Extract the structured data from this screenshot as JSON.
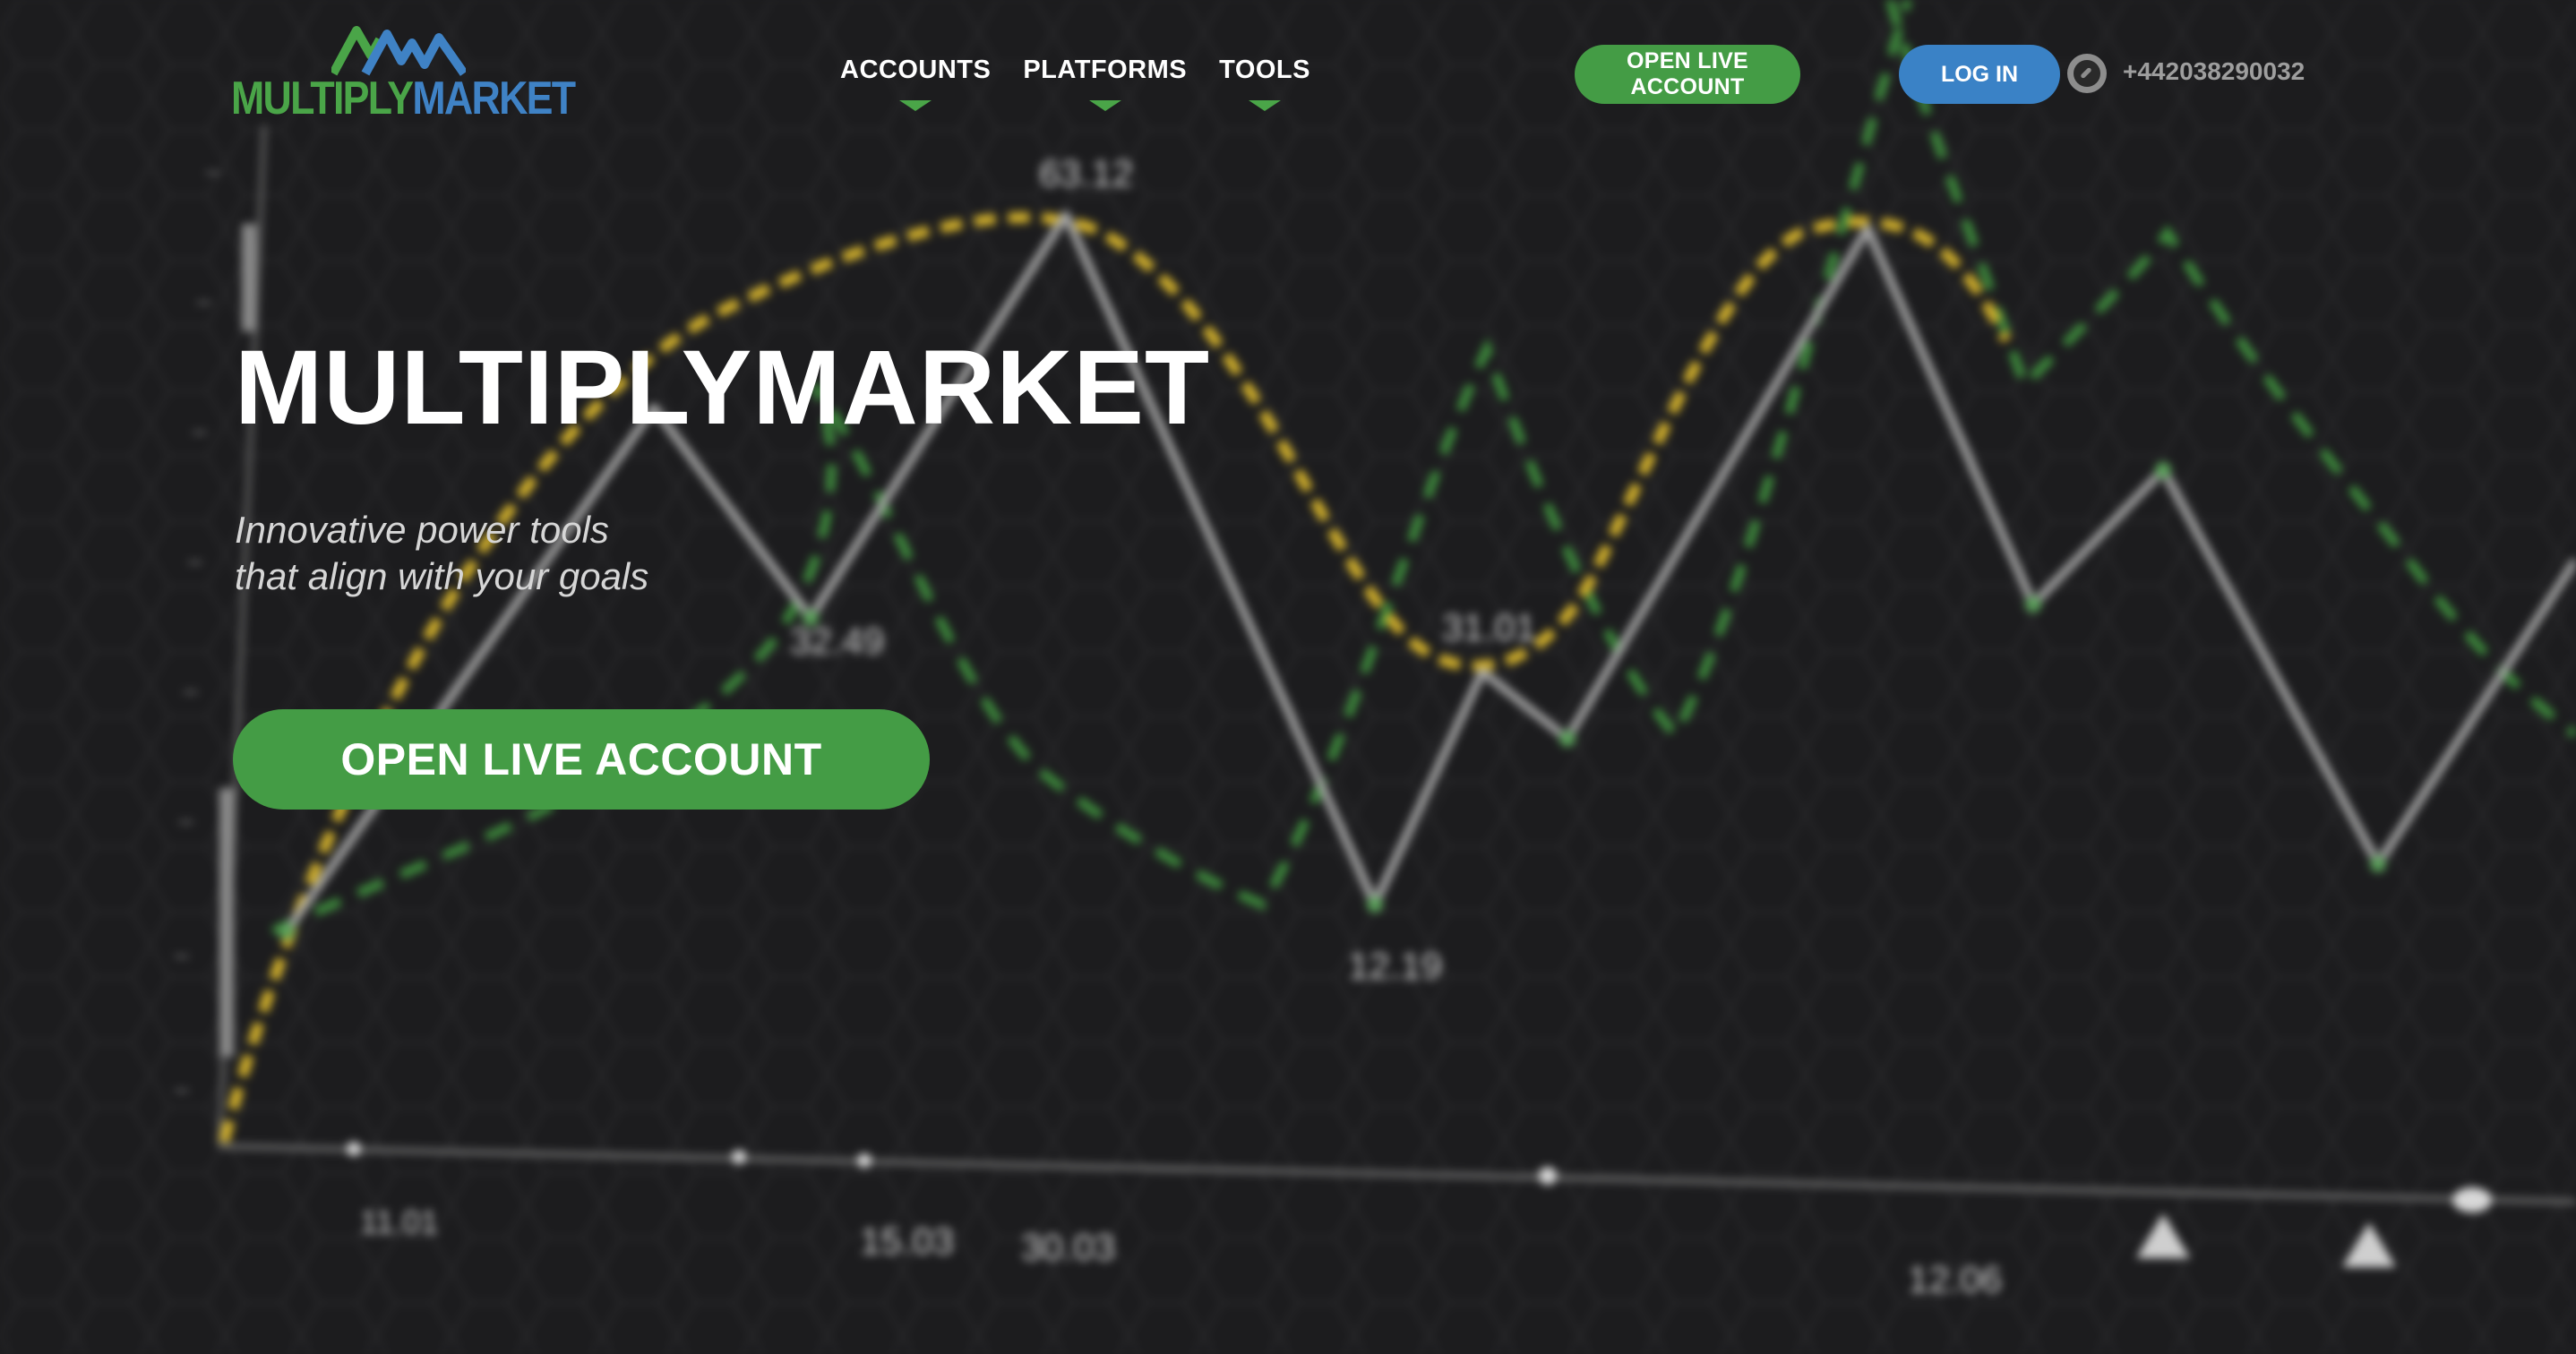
{
  "brand": {
    "name_part1": "MULTIPLY",
    "name_part2": "MARKET",
    "green": "#4aa548",
    "blue": "#3f82c5"
  },
  "nav": {
    "items": [
      {
        "label": "ACCOUNTS"
      },
      {
        "label": "PLATFORMS"
      },
      {
        "label": "TOOLS"
      }
    ]
  },
  "header": {
    "open_account_label": "OPEN LIVE ACCOUNT",
    "login_label": "LOG IN",
    "phone": "+442038290032",
    "phone_icon": "phone-icon"
  },
  "hero": {
    "title": "MULTIPLYMARKET",
    "subtitle_line1": "Innovative power tools",
    "subtitle_line2": "that align with your goals",
    "cta_label": "OPEN LIVE ACCOUNT"
  },
  "background_chart": {
    "point_labels": [
      "63.12",
      "32.49",
      "31.01",
      "12.19"
    ],
    "date_labels": [
      "11.01",
      "15.03",
      "30.03",
      "12.06"
    ]
  }
}
